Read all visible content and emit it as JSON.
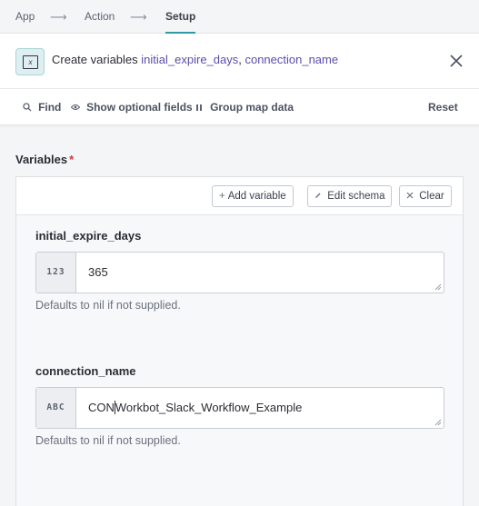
{
  "breadcrumb": {
    "steps": [
      "App",
      "Action",
      "Setup"
    ],
    "separator": "⟶"
  },
  "header": {
    "title_prefix": "Create variables ",
    "var1": "initial_expire_days",
    "sep": ", ",
    "var2": "connection_name",
    "icon_glyph": "x"
  },
  "toolbar": {
    "find": "Find",
    "optional": "Show optional fields",
    "group": "Group map data",
    "reset": "Reset"
  },
  "variables": {
    "label": "Variables",
    "required_mark": "*",
    "add": "Add variable",
    "edit": "Edit schema",
    "clear": "Clear",
    "fields": [
      {
        "name": "initial_expire_days",
        "type": "123",
        "value": "365",
        "hint": "Defaults to nil if not supplied."
      },
      {
        "name": "connection_name",
        "type": "ABC",
        "value_before": "CON",
        "value_after": "Workbot_Slack_Workflow_Example",
        "hint": "Defaults to nil if not supplied."
      }
    ]
  }
}
